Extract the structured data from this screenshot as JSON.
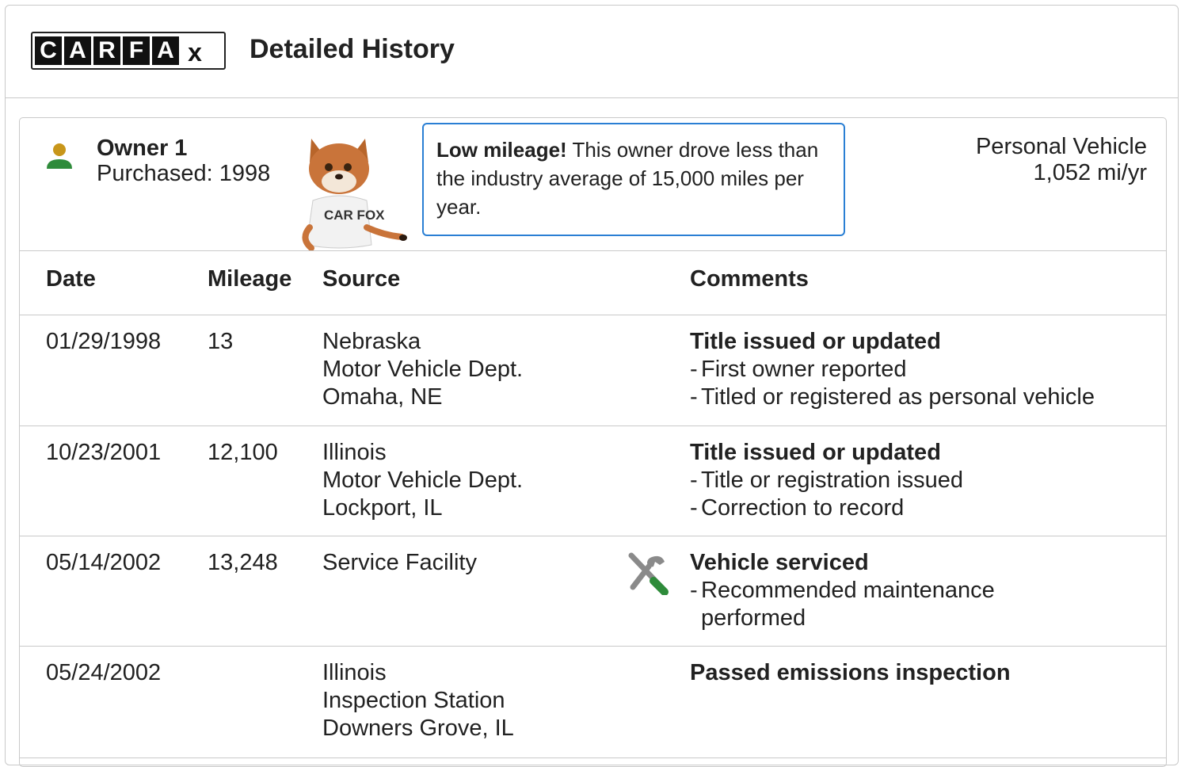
{
  "header": {
    "logo_letters": [
      "C",
      "A",
      "R",
      "F",
      "A",
      "x"
    ],
    "title": "Detailed History"
  },
  "owner": {
    "name": "Owner 1",
    "purchased": "Purchased: 1998",
    "callout_bold": "Low mileage!",
    "callout_text": "This owner drove less than the industry average of 15,000 miles per year.",
    "usage_type": "Personal Vehicle",
    "usage_miles": "1,052 mi/yr",
    "fox_shirt": "CAR FOX"
  },
  "table": {
    "columns": [
      "Date",
      "Mileage",
      "Source",
      "Comments"
    ],
    "rows": [
      {
        "date": "01/29/1998",
        "mileage": "13",
        "source": [
          "Nebraska",
          "Motor Vehicle Dept.",
          "Omaha, NE"
        ],
        "comment_head": "Title issued or updated",
        "comment_items": [
          "First owner reported",
          "Titled or registered as personal vehicle"
        ]
      },
      {
        "date": "10/23/2001",
        "mileage": "12,100",
        "source": [
          "Illinois",
          "Motor Vehicle Dept.",
          "Lockport, IL"
        ],
        "comment_head": "Title issued or updated",
        "comment_items": [
          "Title or registration issued",
          "Correction to record"
        ]
      },
      {
        "date": "05/14/2002",
        "mileage": "13,248",
        "source": [
          "Service Facility"
        ],
        "icon": "wrench-screwdriver-icon",
        "comment_head": "Vehicle serviced",
        "comment_items": [
          "Recommended maintenance performed"
        ]
      },
      {
        "date": "05/24/2002",
        "mileage": "",
        "source": [
          "Illinois",
          "Inspection Station",
          "Downers Grove, IL"
        ],
        "comment_head": "Passed emissions inspection",
        "comment_items": []
      }
    ]
  },
  "colors": {
    "callout_border": "#2a7fd4",
    "owner_head": "#c8961a",
    "owner_body": "#2e8b3a",
    "tool_grey": "#8a8a8a",
    "tool_green": "#2e8b3a"
  }
}
